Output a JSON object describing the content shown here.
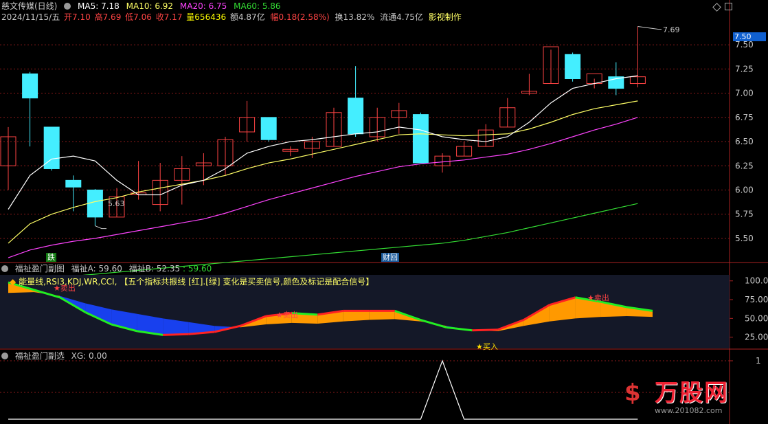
{
  "header": {
    "title": "慈文传媒(日线)",
    "ma": [
      {
        "label": "MA5: 7.18",
        "color": "#ffffff"
      },
      {
        "label": "MA10: 6.92",
        "color": "#ffff66"
      },
      {
        "label": "MA20: 6.75",
        "color": "#ff44ff"
      },
      {
        "label": "MA60: 5.86",
        "color": "#33dd33"
      }
    ],
    "info": [
      {
        "text": "2024/11/15/五",
        "color": "#c8c8c8"
      },
      {
        "text": "开7.10",
        "color": "#ff4444"
      },
      {
        "text": "高7.69",
        "color": "#ff4444"
      },
      {
        "text": "低7.06",
        "color": "#ff4444"
      },
      {
        "text": "收7.17",
        "color": "#ff4444"
      },
      {
        "text": "量656436",
        "color": "#ffff00"
      },
      {
        "text": "额4.87亿",
        "color": "#c8c8c8"
      },
      {
        "text": "幅0.18(2.58%)",
        "color": "#ff4444"
      },
      {
        "text": "换13.82%",
        "color": "#c8c8c8"
      },
      {
        "text": "流通4.75亿",
        "color": "#c8c8c8"
      },
      {
        "text": "影视制作",
        "color": "#ffff66"
      }
    ]
  },
  "markers": {
    "high_label": "7.69",
    "low_label": "5.63",
    "current_price": "7.50",
    "tag_die": "跌",
    "tag_caibao": "财回"
  },
  "panel2": {
    "title": "福祉盈门副图",
    "a_label": "福祉A: 59.60",
    "b_label": "福祉B: 52.35",
    "b_value": ": 59.60",
    "desc_head": "能量线,RSI3,KDJ,WR,CCI,",
    "desc_body": "【五个指标共振线 [红].[绿] 变化是买卖信号,颜色及标记是配合信号】",
    "sell_label": "卖出",
    "buy_label": "买入"
  },
  "panel3": {
    "title": "福祉盈门副选",
    "xg_label": "XG: 0.00"
  },
  "watermark": {
    "brand": "万股网",
    "url": "www.201082.com"
  },
  "colors": {
    "up": "#ff4444",
    "down": "#44eeff",
    "ma5": "#ffffff",
    "ma10": "#ffff66",
    "ma20": "#ff44ff",
    "ma60": "#33dd33",
    "grid": "#8b1a1a"
  },
  "chart_data": [
    {
      "type": "candlestick",
      "title": "慈文传媒(日线)",
      "y_ticks": [
        5.5,
        5.75,
        6.0,
        6.25,
        6.5,
        6.75,
        7.0,
        7.25,
        7.5
      ],
      "ylim": [
        5.35,
        7.75
      ],
      "candles": [
        {
          "o": 6.25,
          "h": 6.65,
          "l": 6.0,
          "c": 6.55
        },
        {
          "o": 7.2,
          "h": 7.22,
          "l": 6.45,
          "c": 6.95
        },
        {
          "o": 6.65,
          "h": 6.65,
          "l": 6.2,
          "c": 6.22
        },
        {
          "o": 6.1,
          "h": 6.15,
          "l": 5.78,
          "c": 6.03
        },
        {
          "o": 6.0,
          "h": 6.01,
          "l": 5.63,
          "c": 5.72
        },
        {
          "o": 5.72,
          "h": 6.02,
          "l": 5.72,
          "c": 5.93
        },
        {
          "o": 5.95,
          "h": 6.3,
          "l": 5.9,
          "c": 5.97
        },
        {
          "o": 5.85,
          "h": 6.28,
          "l": 5.78,
          "c": 6.1
        },
        {
          "o": 6.1,
          "h": 6.35,
          "l": 5.85,
          "c": 6.22
        },
        {
          "o": 6.25,
          "h": 6.38,
          "l": 6.05,
          "c": 6.28
        },
        {
          "o": 6.25,
          "h": 6.55,
          "l": 6.15,
          "c": 6.52
        },
        {
          "o": 6.6,
          "h": 6.92,
          "l": 6.5,
          "c": 6.75
        },
        {
          "o": 6.75,
          "h": 6.75,
          "l": 6.5,
          "c": 6.52
        },
        {
          "o": 6.4,
          "h": 6.45,
          "l": 6.35,
          "c": 6.42
        },
        {
          "o": 6.43,
          "h": 6.55,
          "l": 6.33,
          "c": 6.5
        },
        {
          "o": 6.45,
          "h": 6.85,
          "l": 6.45,
          "c": 6.8
        },
        {
          "o": 6.95,
          "h": 7.28,
          "l": 6.55,
          "c": 6.58
        },
        {
          "o": 6.55,
          "h": 6.85,
          "l": 6.5,
          "c": 6.75
        },
        {
          "o": 6.75,
          "h": 6.9,
          "l": 6.58,
          "c": 6.82
        },
        {
          "o": 6.78,
          "h": 6.8,
          "l": 6.28,
          "c": 6.28
        },
        {
          "o": 6.25,
          "h": 6.38,
          "l": 6.18,
          "c": 6.35
        },
        {
          "o": 6.35,
          "h": 6.5,
          "l": 6.35,
          "c": 6.45
        },
        {
          "o": 6.45,
          "h": 6.68,
          "l": 6.45,
          "c": 6.62
        },
        {
          "o": 6.65,
          "h": 6.95,
          "l": 6.65,
          "c": 6.85
        },
        {
          "o": 7.0,
          "h": 7.2,
          "l": 6.98,
          "c": 7.02
        },
        {
          "o": 7.1,
          "h": 7.45,
          "l": 7.1,
          "c": 7.48
        },
        {
          "o": 7.4,
          "h": 7.42,
          "l": 7.12,
          "c": 7.15
        },
        {
          "o": 7.1,
          "h": 7.15,
          "l": 7.05,
          "c": 7.2
        },
        {
          "o": 7.17,
          "h": 7.32,
          "l": 6.98,
          "c": 7.05
        },
        {
          "o": 7.1,
          "h": 7.69,
          "l": 7.06,
          "c": 7.17
        }
      ],
      "ma5": [
        5.8,
        6.15,
        6.32,
        6.35,
        6.3,
        6.1,
        5.95,
        5.95,
        6.05,
        6.1,
        6.22,
        6.38,
        6.45,
        6.5,
        6.52,
        6.55,
        6.58,
        6.6,
        6.65,
        6.62,
        6.55,
        6.52,
        6.5,
        6.55,
        6.7,
        6.9,
        7.05,
        7.1,
        7.15,
        7.18
      ],
      "ma10": [
        5.45,
        5.65,
        5.75,
        5.82,
        5.88,
        5.92,
        5.98,
        6.02,
        6.06,
        6.1,
        6.15,
        6.22,
        6.28,
        6.32,
        6.37,
        6.42,
        6.47,
        6.52,
        6.57,
        6.58,
        6.57,
        6.56,
        6.57,
        6.58,
        6.63,
        6.7,
        6.78,
        6.84,
        6.88,
        6.92
      ],
      "ma20": [
        5.3,
        5.38,
        5.43,
        5.47,
        5.5,
        5.54,
        5.58,
        5.62,
        5.66,
        5.7,
        5.76,
        5.83,
        5.9,
        5.96,
        6.02,
        6.08,
        6.14,
        6.19,
        6.24,
        6.27,
        6.29,
        6.31,
        6.34,
        6.37,
        6.42,
        6.48,
        6.55,
        6.62,
        6.68,
        6.75
      ],
      "ma60": [
        5.05,
        5.07,
        5.09,
        5.11,
        5.13,
        5.15,
        5.17,
        5.19,
        5.21,
        5.23,
        5.25,
        5.27,
        5.29,
        5.31,
        5.33,
        5.35,
        5.37,
        5.39,
        5.41,
        5.43,
        5.45,
        5.48,
        5.52,
        5.56,
        5.61,
        5.66,
        5.71,
        5.76,
        5.81,
        5.86
      ]
    },
    {
      "type": "area",
      "title": "福祉盈门副图",
      "y_ticks": [
        25.0,
        50.0,
        75.0,
        100.0
      ],
      "ylim": [
        10,
        108
      ],
      "series": [
        {
          "name": "福祉A",
          "values": [
            98,
            88,
            78,
            58,
            42,
            33,
            28,
            29,
            32,
            40,
            53,
            57,
            55,
            60,
            60,
            60,
            48,
            38,
            34,
            35,
            48,
            68,
            78,
            72,
            65,
            60
          ]
        },
        {
          "name": "福祉B",
          "values": [
            84,
            85,
            80,
            70,
            62,
            56,
            50,
            45,
            40,
            38,
            42,
            44,
            43,
            46,
            48,
            49,
            46,
            40,
            34,
            33,
            40,
            46,
            50,
            52,
            53,
            52
          ]
        }
      ]
    },
    {
      "type": "line",
      "title": "福祉盈门副选",
      "y_ticks": [
        1
      ],
      "series": [
        {
          "name": "XG",
          "values": [
            0,
            0,
            0,
            0,
            0,
            0,
            0,
            0,
            0,
            0,
            0,
            0,
            0,
            0,
            0,
            0,
            0,
            0,
            0,
            0,
            1,
            0,
            0,
            0,
            0,
            0,
            0,
            0,
            0,
            0
          ]
        }
      ]
    }
  ]
}
